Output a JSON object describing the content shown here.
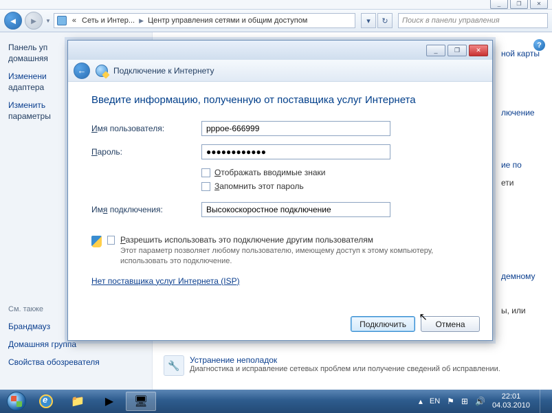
{
  "titlebar": {
    "min": "_",
    "max": "❐",
    "close": "✕"
  },
  "nav": {
    "crumb_prefix": "«",
    "crumb1": "Сеть и Интер...",
    "crumb2": "Центр управления сетями и общим доступом",
    "search_placeholder": "Поиск в панели управления"
  },
  "sidebar": {
    "title1": "Панель уп",
    "title2": "домашняя",
    "links": [
      "Изменени",
      "адаптера",
      "Изменить",
      "параметры"
    ],
    "section": "См. также",
    "bottom": [
      "Брандмауз",
      "Домашняя группа",
      "Свойства обозревателя"
    ]
  },
  "main": {
    "right_links": [
      "ной карты",
      "лючение",
      "ие по",
      "ети",
      "демному",
      "ы, или"
    ],
    "trouble_title": "Устранение неполадок",
    "trouble_desc": "Диагностика и исправление сетевых проблем или получение сведений об исправлении."
  },
  "dialog": {
    "window_title": "Подключение к Интернету",
    "heading": "Введите информацию, полученную от поставщика услуг Интернета",
    "user_label_u": "И",
    "user_label_rest": "мя пользователя:",
    "user_value": "pppoe-666999",
    "pass_label_u": "П",
    "pass_label_rest": "ароль:",
    "pass_value": "●●●●●●●●●●●●",
    "show_chars": "Отображать вводимые знаки",
    "show_chars_u": "О",
    "remember": "апомнить этот пароль",
    "remember_u": "З",
    "conn_label": "Им",
    "conn_label_u": "я",
    "conn_label_rest": " подключения:",
    "conn_value": "Высокоскоростное подключение",
    "share_u": "Р",
    "share_rest": "азрешить использовать это подключение другим пользователям",
    "share_desc": "Этот параметр позволяет любому пользователю, имеющему доступ к этому компьютеру, использовать это подключение.",
    "isp_link": "Нет поставщика услуг Интернета (ISP)",
    "btn_connect": "Подключить",
    "btn_cancel": "Отмена"
  },
  "taskbar": {
    "lang": "EN",
    "time": "22:01",
    "date": "04.03.2010"
  }
}
